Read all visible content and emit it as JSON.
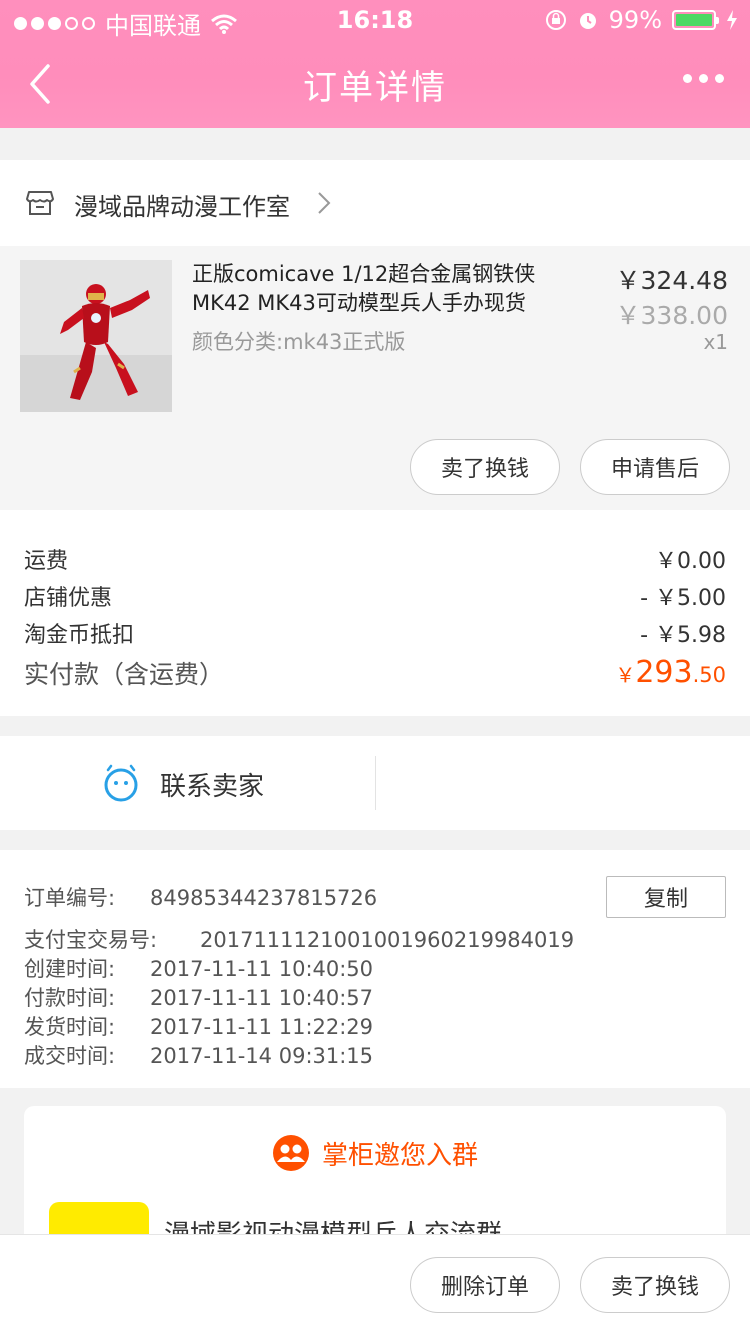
{
  "status_bar": {
    "carrier": "中国联通",
    "time": "16:18",
    "battery": "99%",
    "battery_level": 0.99
  },
  "nav": {
    "title": "订单详情"
  },
  "store": {
    "name": "漫域品牌动漫工作室"
  },
  "product": {
    "title": "正版comicave 1/12超合金属钢铁侠MK42 MK43可动模型兵人手办现货",
    "sku": "颜色分类:mk43正式版",
    "price": "￥324.48",
    "original_price": "￥338.00",
    "quantity": "x1",
    "buttons": {
      "sell": "卖了换钱",
      "after_sale": "申请售后"
    }
  },
  "fees": {
    "shipping_label": "运费",
    "shipping_value": "￥0.00",
    "store_discount_label": "店铺优惠",
    "store_discount_value": "- ￥5.00",
    "coin_label": "淘金币抵扣",
    "coin_value": "- ￥5.98",
    "total_label": "实付款（含运费）",
    "total_symbol": "￥",
    "total_int": "293",
    "total_dec": ".50"
  },
  "contact": {
    "label": "联系卖家"
  },
  "order_info": {
    "order_no_label": "订单编号:",
    "order_no": "84985344237815726",
    "copy_label": "复制",
    "alipay_label": "支付宝交易号:",
    "alipay_no": "2017111121001001960219984019",
    "created_label": "创建时间:",
    "created": "2017-11-11 10:40:50",
    "paid_label": "付款时间:",
    "paid": "2017-11-11 10:40:57",
    "shipped_label": "发货时间:",
    "shipped": "2017-11-11 11:22:29",
    "completed_label": "成交时间:",
    "completed": "2017-11-14 09:31:15"
  },
  "group": {
    "title": "掌柜邀您入群",
    "name": "漫域影视动漫模型兵人交流群"
  },
  "bottom_bar": {
    "delete": "删除订单",
    "sell": "卖了换钱"
  },
  "colors": {
    "header": "#ff8dbb",
    "accent": "#ff5000",
    "battery": "#4cd964"
  }
}
